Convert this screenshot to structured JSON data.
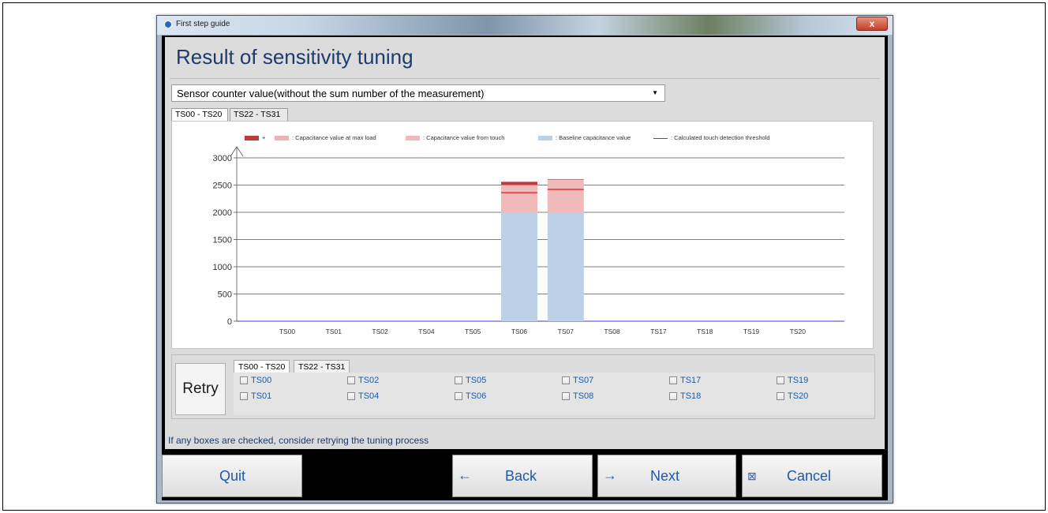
{
  "window": {
    "title": "First step guide",
    "close_glyph": "x"
  },
  "page": {
    "title": "Result of sensitivity tuning",
    "dropdown_value": "Sensor counter value(without the sum number of the measurement)"
  },
  "chart_tabs": [
    "TS00 - TS20",
    "TS22 - TS31"
  ],
  "legend": [
    {
      "label": "+",
      "color": "#c0393b"
    },
    {
      "label": ": Capacitance value at max load",
      "color": "#e8b4b4"
    },
    {
      "label": ": Capacitance value from touch",
      "color": "#f0baba"
    },
    {
      "label": ": Baseline capacitance value",
      "color": "#bcd0e8"
    },
    {
      "label": ": Calculated touch detection threshold",
      "color": "#d42020"
    }
  ],
  "chart_data": {
    "type": "bar",
    "stacked": true,
    "categories": [
      "TS00",
      "TS01",
      "TS02",
      "TS04",
      "TS05",
      "TS06",
      "TS07",
      "TS08",
      "TS17",
      "TS18",
      "TS19",
      "TS20"
    ],
    "series": [
      {
        "name": ": Baseline capacitance value",
        "values": [
          0,
          0,
          0,
          0,
          0,
          2000,
          2000,
          0,
          0,
          0,
          0,
          0
        ],
        "color": "#bcd0e8"
      },
      {
        "name": ": Capacitance value from touch",
        "values": [
          0,
          0,
          0,
          0,
          0,
          500,
          600,
          0,
          0,
          0,
          0,
          0
        ],
        "color": "#f0baba"
      },
      {
        "name": "+",
        "values": [
          0,
          0,
          0,
          0,
          0,
          60,
          10,
          0,
          0,
          0,
          0,
          0
        ],
        "color": "#c0393b"
      }
    ],
    "threshold": [
      null,
      null,
      null,
      null,
      null,
      2360,
      2420,
      null,
      null,
      null,
      null,
      null
    ],
    "yticks": [
      0,
      500,
      1000,
      1500,
      2000,
      2500,
      3000
    ],
    "ylim": [
      0,
      3000
    ],
    "grid": true
  },
  "retry": {
    "button_label": "Retry",
    "tabs": [
      "TS00 - TS20",
      "TS22 - TS31"
    ],
    "checkboxes": [
      [
        "TS00",
        "TS01"
      ],
      [
        "TS02",
        "TS04"
      ],
      [
        "TS05",
        "TS06"
      ],
      [
        "TS07",
        "TS08"
      ],
      [
        "TS17",
        "TS18"
      ],
      [
        "TS19",
        "TS20"
      ]
    ]
  },
  "hint": "If any boxes are checked, consider retrying the tuning process",
  "nav": {
    "quit": "Quit",
    "back": "Back",
    "next": "Next",
    "cancel": "Cancel",
    "back_icon": "←",
    "next_icon": "→",
    "cancel_icon": "⊠"
  }
}
